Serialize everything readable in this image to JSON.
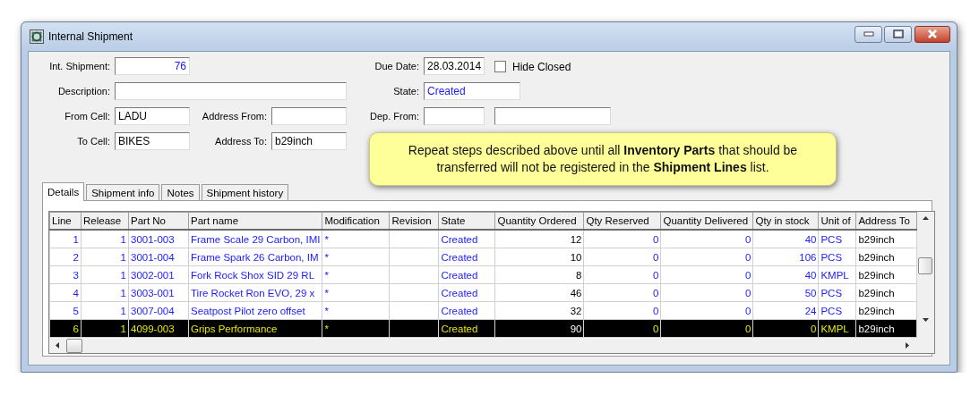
{
  "window": {
    "title": "Internal Shipment"
  },
  "form": {
    "int_shipment": {
      "label": "Int. Shipment:",
      "value": "76"
    },
    "description": {
      "label": "Description:"
    },
    "from_cell": {
      "label": "From Cell:",
      "value": "LADU"
    },
    "address_from": {
      "label": "Address From:"
    },
    "to_cell": {
      "label": "To Cell:",
      "value": "BIKES"
    },
    "address_to": {
      "label": "Address To:",
      "value": "b29inch"
    },
    "due_date": {
      "label": "Due Date:",
      "value": "28.03.2014"
    },
    "hide_closed": {
      "label": "Hide Closed",
      "checked": false
    },
    "state": {
      "label": "State:",
      "value": "Created"
    },
    "dep_from": {
      "label": "Dep. From:"
    }
  },
  "tooltip": {
    "text": "Repeat steps described above until all **Inventory Parts** that should be transferred will not be registered in the **Shipment Lines** list."
  },
  "tabs": [
    {
      "label": "Details",
      "selected": true
    },
    {
      "label": "Shipment info",
      "selected": false
    },
    {
      "label": "Notes",
      "selected": false
    },
    {
      "label": "Shipment history",
      "selected": false
    }
  ],
  "table": {
    "columns": [
      {
        "label": "Line",
        "kind": "number",
        "read_only": false
      },
      {
        "label": "Release",
        "kind": "number",
        "read_only": false
      },
      {
        "label": "Part No",
        "kind": "text",
        "read_only": false
      },
      {
        "label": "Part name",
        "kind": "text",
        "read_only": false
      },
      {
        "label": "Modification",
        "kind": "text",
        "read_only": false
      },
      {
        "label": "Revision",
        "kind": "text"
      },
      {
        "label": "State",
        "kind": "text",
        "read_only": false
      },
      {
        "label": "Quantity Ordered",
        "kind": "number",
        "read_only": true
      },
      {
        "label": "Qty Reserved",
        "kind": "number",
        "read_only": false
      },
      {
        "label": "Quantity Delivered",
        "kind": "number",
        "read_only": false
      },
      {
        "label": "Qty in stock",
        "kind": "number",
        "read_only": false
      },
      {
        "label": "Unit of",
        "kind": "text",
        "read_only": false
      },
      {
        "label": "Address To",
        "kind": "text",
        "read_only": true
      }
    ],
    "rows": [
      {
        "selected": false,
        "cells": [
          "1",
          "1",
          "3001-003",
          "Frame Scale 29 Carbon, IMI",
          "*",
          "",
          "Created",
          "12",
          "0",
          "0",
          "40",
          "PCS",
          "b29inch"
        ]
      },
      {
        "selected": false,
        "cells": [
          "2",
          "1",
          "3001-004",
          "Frame Spark 26 Carbon, IM",
          "*",
          "",
          "Created",
          "10",
          "0",
          "0",
          "106",
          "PCS",
          "b29inch"
        ]
      },
      {
        "selected": false,
        "cells": [
          "3",
          "1",
          "3002-001",
          "Fork Rock Shox SID 29 RL",
          "*",
          "",
          "Created",
          "8",
          "0",
          "0",
          "40",
          "KMPL",
          "b29inch"
        ]
      },
      {
        "selected": false,
        "cells": [
          "4",
          "1",
          "3003-001",
          "Tire Rocket Ron EVO, 29 x",
          "*",
          "",
          "Created",
          "46",
          "0",
          "0",
          "50",
          "PCS",
          "b29inch"
        ]
      },
      {
        "selected": false,
        "cells": [
          "5",
          "1",
          "3007-004",
          "Seatpost Pilot zero offset",
          "*",
          "",
          "Created",
          "32",
          "0",
          "0",
          "24",
          "PCS",
          "b29inch"
        ]
      },
      {
        "selected": true,
        "cells": [
          "6",
          "1",
          "4099-003",
          "Grips Performance",
          "*",
          "",
          "Created",
          "90",
          "0",
          "0",
          "0",
          "KMPL",
          "b29inch"
        ]
      }
    ]
  }
}
